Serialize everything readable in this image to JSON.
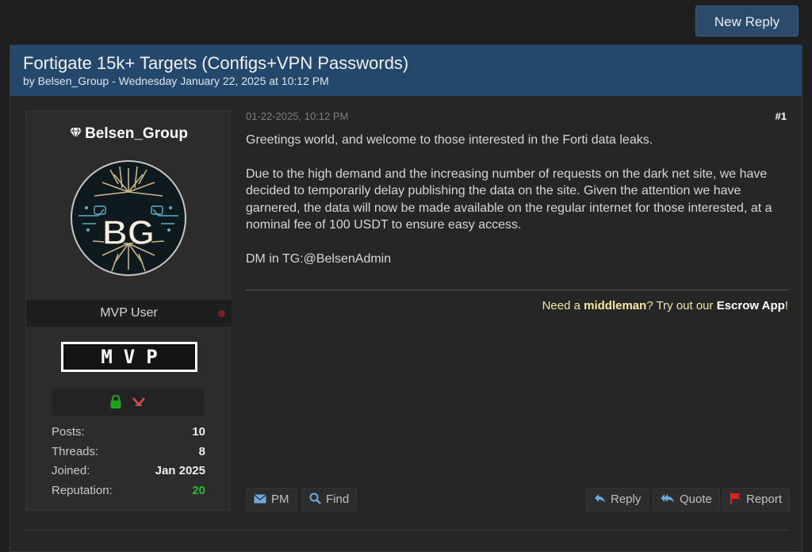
{
  "actions": {
    "new_reply": "New Reply"
  },
  "thread": {
    "title": "Fortigate 15k+ Targets (Configs+VPN Passwords)",
    "byline": "by Belsen_Group - Wednesday January 22, 2025 at 10:12 PM"
  },
  "user": {
    "username": "Belsen_Group",
    "avatar_text": "BG",
    "role": "MVP User",
    "badge": "MVP",
    "icons": [
      "lock-icon",
      "rank-chevron-icon"
    ],
    "stats": [
      {
        "label": "Posts:",
        "value": "10"
      },
      {
        "label": "Threads:",
        "value": "8"
      },
      {
        "label": "Joined:",
        "value": "Jan 2025"
      },
      {
        "label": "Reputation:",
        "value": "20"
      }
    ]
  },
  "post": {
    "date": "01-22-2025, 10:12 PM",
    "number": "#1",
    "paragraphs": [
      "Greetings world, and welcome to those interested in the Forti data leaks.",
      "Due to the high demand and the increasing number of requests on the dark net  site, we have decided to temporarily delay publishing the data on the site. Given the attention we have garnered, the data will now be made available on the regular internet for those interested, at a nominal fee of 100 USDT to ensure easy access.",
      "DM in TG:@BelsenAdmin"
    ]
  },
  "signature": {
    "prefix": "Need a ",
    "middleman": "middleman",
    "middle": "? Try out our ",
    "app": "Escrow App",
    "suffix": "!"
  },
  "buttons": {
    "pm": "PM",
    "find": "Find",
    "reply": "Reply",
    "quote": "Quote",
    "report": "Report"
  },
  "colors": {
    "header_bg": "#24486b",
    "button_bg": "#2c4a6b",
    "reputation": "#2fb92f",
    "lock": "#22a022",
    "report_flag": "#e02020"
  }
}
